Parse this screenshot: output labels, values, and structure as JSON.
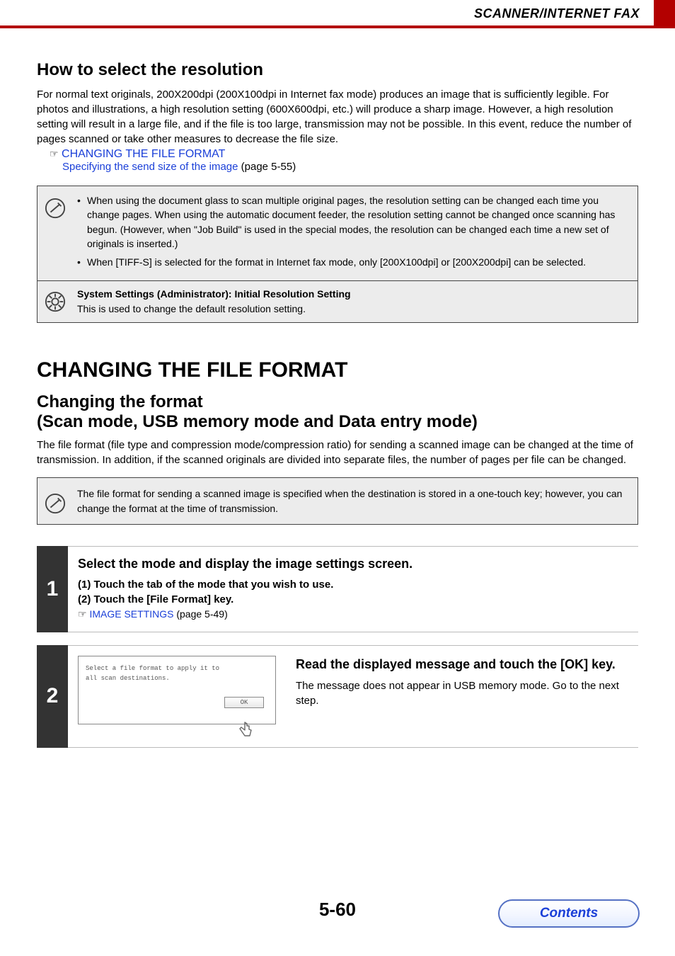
{
  "chart_data": null,
  "header": {
    "section": "SCANNER/INTERNET FAX"
  },
  "resolution": {
    "heading": "How to select the resolution",
    "para": "For normal text originals, 200X200dpi (200X100dpi in Internet fax mode) produces an image that is sufficiently legible. For photos and illustrations, a high resolution setting (600X600dpi, etc.) will produce a sharp image. However, a high resolution setting will result in a large file, and if the file is too large, transmission may not be possible. In this event, reduce the number of pages scanned or take other measures to decrease the file size.",
    "link1": "CHANGING THE FILE FORMAT",
    "link2": "Specifying the send size of the image",
    "link2_after": " (page 5-55)"
  },
  "noteA": {
    "bullet1": "When using the document glass to scan multiple original pages, the resolution setting can be changed each time you change pages. When using the automatic document feeder, the resolution setting cannot be changed once scanning has begun. (However, when \"Job Build\" is used in the special modes, the resolution can be changed each time a new set of originals is inserted.)",
    "bullet2": "When [TIFF-S] is selected for the format in Internet fax mode, only [200X100dpi] or [200X200dpi] can be selected."
  },
  "admin": {
    "bold": "System Settings (Administrator): Initial Resolution Setting",
    "text": "This is used to change the default resolution setting."
  },
  "fileformat": {
    "h1": "CHANGING THE FILE FORMAT",
    "h2a": "Changing the format",
    "h2b": "(Scan mode, USB memory mode and Data entry mode)",
    "para": "The file format (file type and compression mode/compression ratio) for sending a scanned image can be changed at the time of transmission. In addition, if the scanned originals are divided into separate files, the number of pages per file can be changed.",
    "note": "The file format for sending a scanned image is specified when the destination is stored in a one-touch key; however, you can change the format at the time of transmission."
  },
  "step1": {
    "num": "1",
    "title": "Select the mode and display the image settings screen.",
    "sub1": "(1)  Touch the tab of the mode that you wish to use.",
    "sub2": "(2)  Touch the [File Format] key.",
    "ref_link": "IMAGE SETTINGS",
    "ref_after": " (page 5-49)"
  },
  "step2": {
    "num": "2",
    "ss_line1": "Select a file format to apply it to",
    "ss_line2": "all scan destinations.",
    "ss_ok": "OK",
    "title": "Read the displayed message and touch the [OK] key.",
    "para": "The message does not appear in USB memory mode. Go to the next step."
  },
  "footer": {
    "page": "5-60",
    "contents": "Contents"
  }
}
